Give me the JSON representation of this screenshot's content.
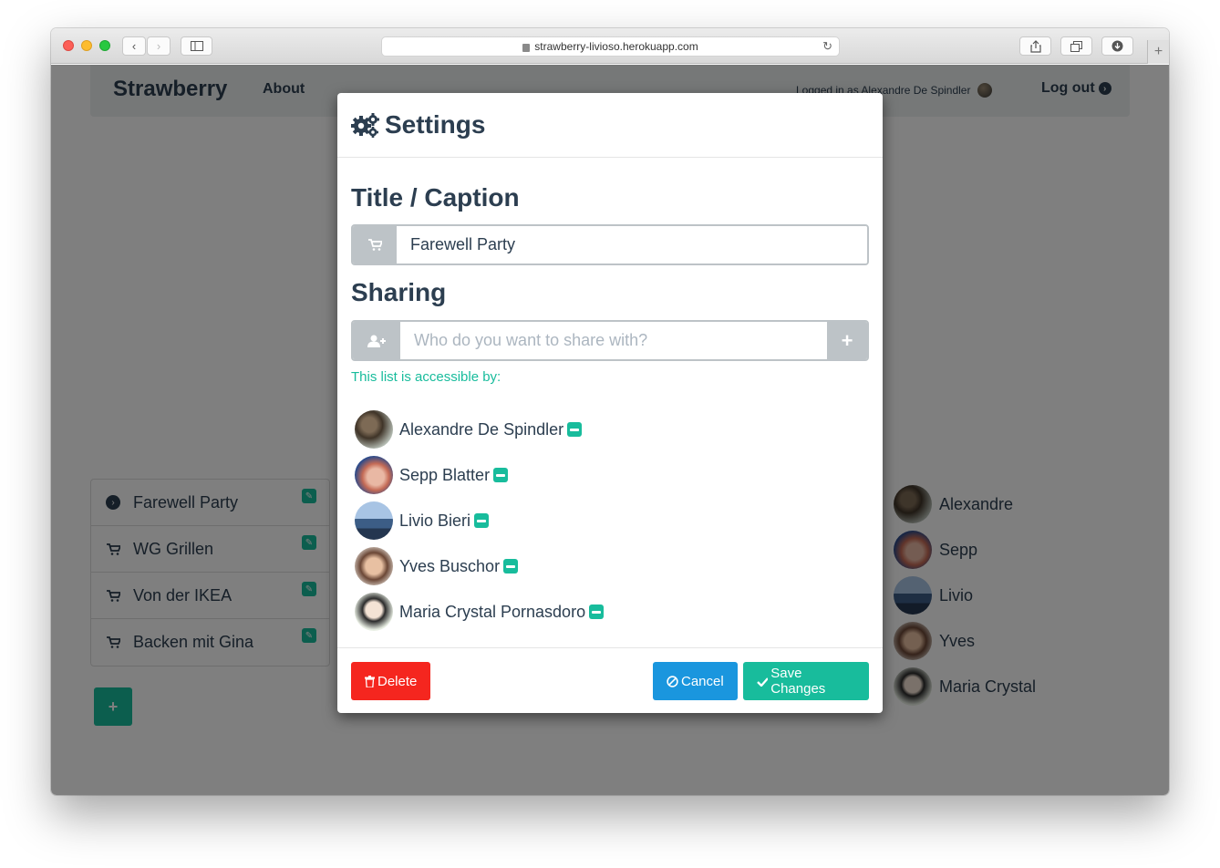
{
  "browser": {
    "url": "strawberry-livioso.herokuapp.com"
  },
  "navbar": {
    "brand": "Strawberry",
    "about": "About",
    "logged_in_as": "Logged in as Alexandre De Spindler",
    "logout": "Log out"
  },
  "lists": [
    {
      "label": "Farewell Party",
      "icon": "chevron-circle-right-icon"
    },
    {
      "label": "WG Grillen",
      "icon": "cart-icon"
    },
    {
      "label": "Von der IKEA",
      "icon": "cart-icon"
    },
    {
      "label": "Backen mit Gina",
      "icon": "cart-icon"
    }
  ],
  "members": [
    "Alexandre",
    "Sepp",
    "Livio",
    "Yves",
    "Maria Crystal"
  ],
  "modal": {
    "title": "Settings",
    "caption_heading": "Title / Caption",
    "caption_value": "Farewell Party",
    "sharing_heading": "Sharing",
    "share_placeholder": "Who do you want to share with?",
    "access_note": "This list is accessible by:",
    "people": [
      "Alexandre De Spindler",
      "Sepp Blatter",
      "Livio Bieri",
      "Yves Buschor",
      "Maria Crystal Pornasdoro"
    ],
    "delete_label": "Delete",
    "cancel_label": "Cancel",
    "save_label": "Save Changes"
  },
  "colors": {
    "primary": "#2c3e50",
    "success": "#18bc9c",
    "danger": "#f5261f",
    "info": "#1a96de"
  }
}
